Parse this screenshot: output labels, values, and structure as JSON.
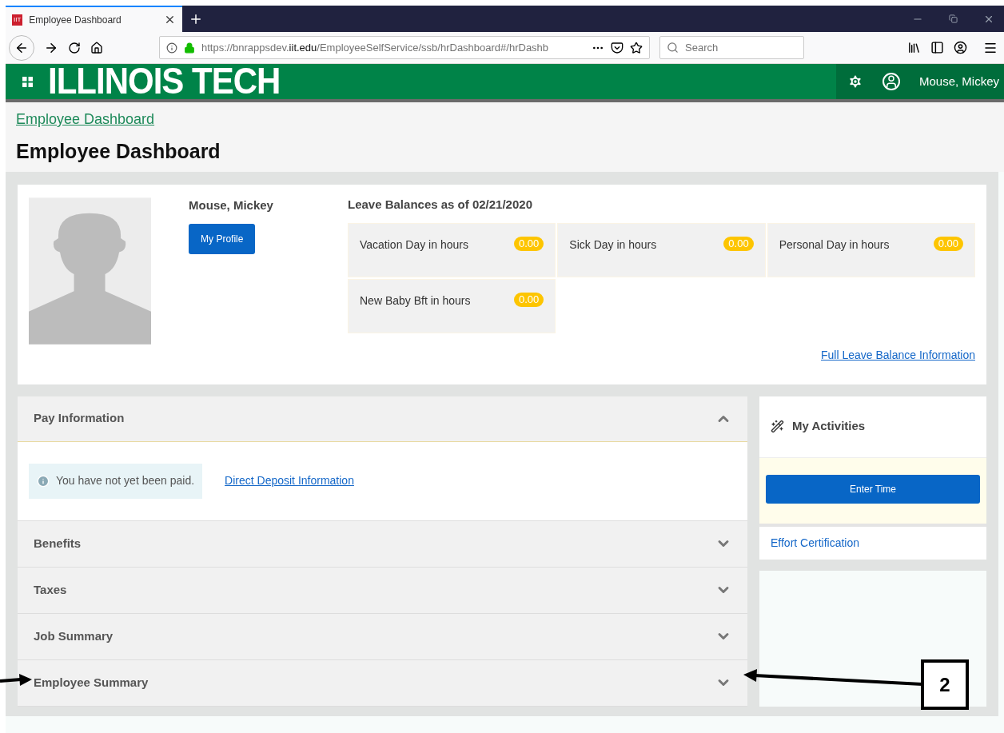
{
  "browser": {
    "tab_title": "Employee Dashboard",
    "tab_favicon": "IIT",
    "url_host": "https://bnrappsdev.",
    "url_domain": "iit.edu",
    "url_path": "/EmployeeSelfService/ssb/hrDashboard#/hrDashb",
    "search_placeholder": "Search"
  },
  "header": {
    "logo": "ILLINOIS TECH",
    "user_name": "Mouse, Mickey"
  },
  "breadcrumb": "Employee Dashboard",
  "page_title": "Employee Dashboard",
  "profile": {
    "name": "Mouse, Mickey",
    "button": "My Profile"
  },
  "leave": {
    "title": "Leave Balances as of 02/21/2020",
    "link": "Full Leave Balance Information",
    "items": [
      {
        "label": "Vacation Day in hours",
        "value": "0.00"
      },
      {
        "label": "Sick Day in hours",
        "value": "0.00"
      },
      {
        "label": "Personal Day in hours",
        "value": "0.00"
      },
      {
        "label": "New Baby Bft in hours",
        "value": "0.00"
      }
    ]
  },
  "sections": [
    {
      "title": "Pay Information",
      "expanded": true,
      "notice": "You have not yet been paid.",
      "link": "Direct Deposit Information"
    },
    {
      "title": "Benefits",
      "expanded": false
    },
    {
      "title": "Taxes",
      "expanded": false
    },
    {
      "title": "Job Summary",
      "expanded": false
    },
    {
      "title": "Employee Summary",
      "expanded": false
    }
  ],
  "activities": {
    "title": "My Activities",
    "button": "Enter Time",
    "link": "Effort Certification"
  },
  "annotation": {
    "label": "2"
  }
}
